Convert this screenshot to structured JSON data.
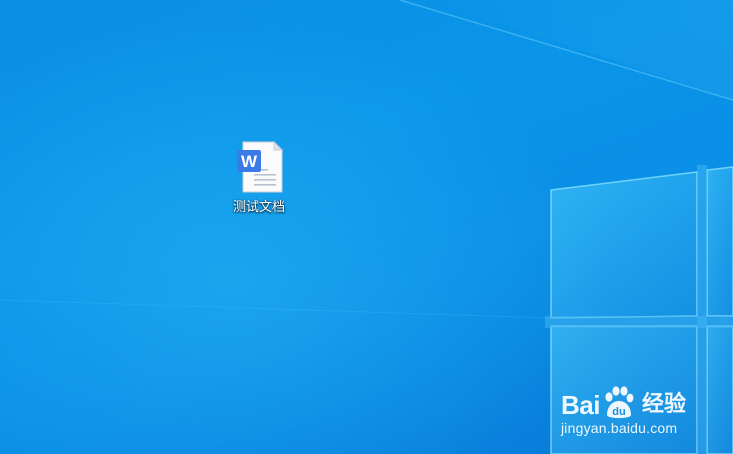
{
  "desktop": {
    "icons": [
      {
        "label": "测试文档",
        "icon": "word-document-icon",
        "badge_letter": "W"
      }
    ]
  },
  "watermark": {
    "brand_left": "Bai",
    "brand_right": "du",
    "brand_cn": "经验",
    "url": "jingyan.baidu.com"
  },
  "colors": {
    "wallpaper_base": "#0a8fe6",
    "window_pane": "#3cc0f5",
    "word_blue": "#3b7be8",
    "label_text": "#ffffff"
  }
}
